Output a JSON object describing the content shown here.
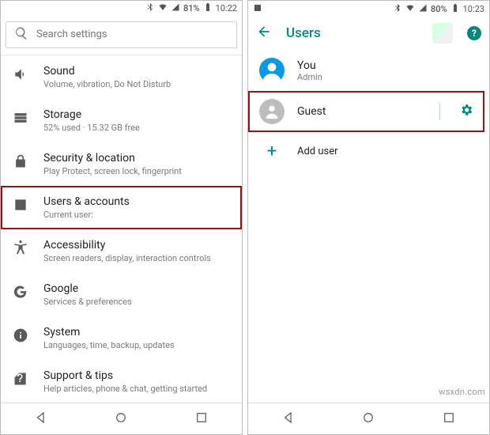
{
  "watermark": "wsxdn.com",
  "left": {
    "status": {
      "battery_pct": "81%",
      "time": "10:22"
    },
    "search_placeholder": "Search settings",
    "items": [
      {
        "icon": "volume",
        "title": "Sound",
        "sub": "Volume, vibration, Do Not Disturb"
      },
      {
        "icon": "storage",
        "title": "Storage",
        "sub": "52% used · 15.32 GB free"
      },
      {
        "icon": "lock",
        "title": "Security & location",
        "sub": "Play Protect, screen lock, fingerprint"
      },
      {
        "icon": "person-box",
        "title": "Users & accounts",
        "sub": "Current user:",
        "highlight": true
      },
      {
        "icon": "a11y",
        "title": "Accessibility",
        "sub": "Screen readers, display, interaction controls"
      },
      {
        "icon": "google",
        "title": "Google",
        "sub": "Services & preferences"
      },
      {
        "icon": "info",
        "title": "System",
        "sub": "Languages, time, backup, updates"
      },
      {
        "icon": "help-tag",
        "title": "Support & tips",
        "sub": "Help articles, phone & chat, getting started"
      }
    ]
  },
  "right": {
    "status": {
      "battery_pct": "80%",
      "time": "10:23"
    },
    "header_title": "Users",
    "help_glyph": "?",
    "users": {
      "you": {
        "title": "You",
        "sub": "Admin"
      },
      "guest": {
        "title": "Guest"
      },
      "add": {
        "title": "Add user"
      }
    }
  }
}
